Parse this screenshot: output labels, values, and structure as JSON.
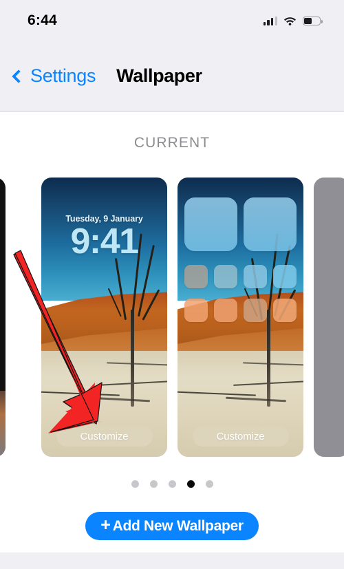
{
  "status_bar": {
    "time": "6:44",
    "cellular_icon": "cellular-bars-icon",
    "wifi_icon": "wifi-icon",
    "battery_icon": "battery-icon",
    "battery_level_percent": 44
  },
  "nav_bar": {
    "back_icon": "chevron-left-icon",
    "back_label": "Settings",
    "title": "Wallpaper"
  },
  "content": {
    "section_header": "CURRENT",
    "cards": [
      {
        "kind": "lock-screen-preview",
        "date": "Tuesday, 9 January",
        "time": "9:41",
        "customize_label": "Customize"
      },
      {
        "kind": "home-screen-preview",
        "customize_label": "Customize",
        "widget_count": 2,
        "app_icon_rows": 2,
        "app_icons_per_row": 4
      }
    ],
    "page_dots": {
      "count": 5,
      "active_index": 3
    },
    "add_button": {
      "plus_glyph": "+",
      "label": "Add New Wallpaper"
    }
  },
  "annotation": {
    "type": "red-arrow",
    "points_to": "Customize",
    "color": "#f22424"
  },
  "colors": {
    "accent_blue": "#0a84ff",
    "page_background": "#f0f0f4",
    "content_background": "#ffffff",
    "section_header_gray": "#8c8c90",
    "dot_inactive": "#c8c8cc",
    "dot_active": "#0a0a0a"
  }
}
